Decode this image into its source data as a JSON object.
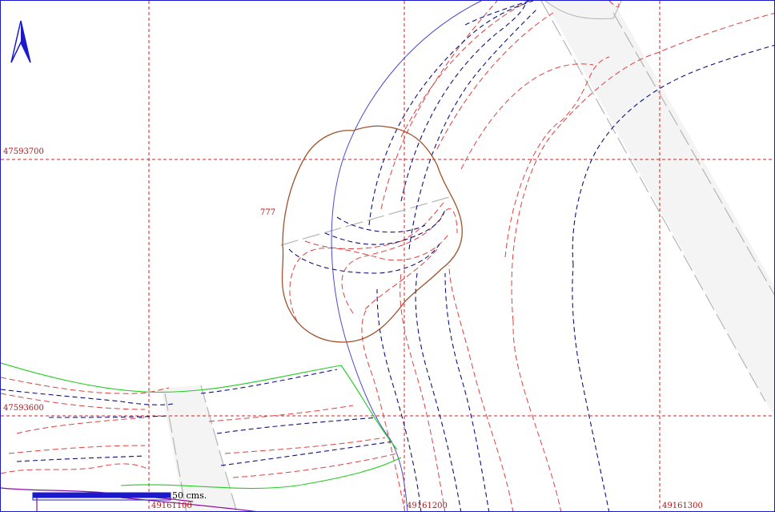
{
  "map": {
    "grid_easting_labels": [
      "49161100",
      "49161200",
      "49161300"
    ],
    "grid_northing_labels": [
      "47593700",
      "47593600"
    ],
    "parcel_label": "777",
    "scale_text": "50  cms.",
    "north_arrow": "north-arrow-icon",
    "colors": {
      "grid": "#d42020",
      "contour_blue": "#10107a",
      "contour_red": "#e04040",
      "boundary_blue": "#4a4ad0",
      "parcel_outline": "#a0522d",
      "green_line": "#22cc22",
      "road_edge": "#b5b5b5"
    }
  }
}
